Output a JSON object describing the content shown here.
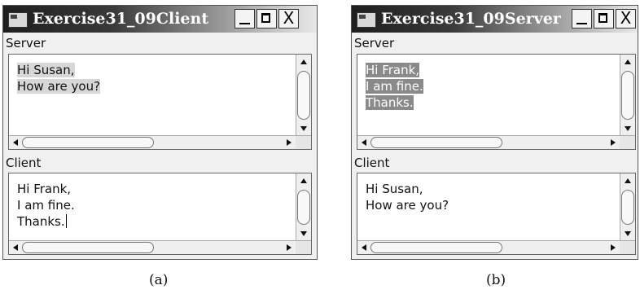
{
  "figure_a": {
    "caption": "(a)",
    "window": {
      "title": "Exercise31_09Client",
      "controls": {
        "minimize": "_",
        "maximize": "□",
        "close": "X"
      },
      "server_label": "Server",
      "server_lines": [
        "Hi Susan,",
        "How are you?"
      ],
      "client_label": "Client",
      "client_lines": [
        "Hi Frank,",
        "I am fine.",
        "Thanks."
      ]
    }
  },
  "figure_b": {
    "caption": "(b)",
    "window": {
      "title": "Exercise31_09Server",
      "controls": {
        "minimize": "_",
        "maximize": "□",
        "close": "X"
      },
      "server_label": "Server",
      "server_lines": [
        "Hi Frank,",
        "I am fine.",
        "Thanks."
      ],
      "client_label": "Client",
      "client_lines": [
        "Hi Susan,",
        "How are you?"
      ]
    }
  },
  "icons": [
    "app-icon",
    "minimize-icon",
    "maximize-icon",
    "close-icon",
    "scroll-up-icon",
    "scroll-down-icon",
    "scroll-left-icon",
    "scroll-right-icon"
  ]
}
